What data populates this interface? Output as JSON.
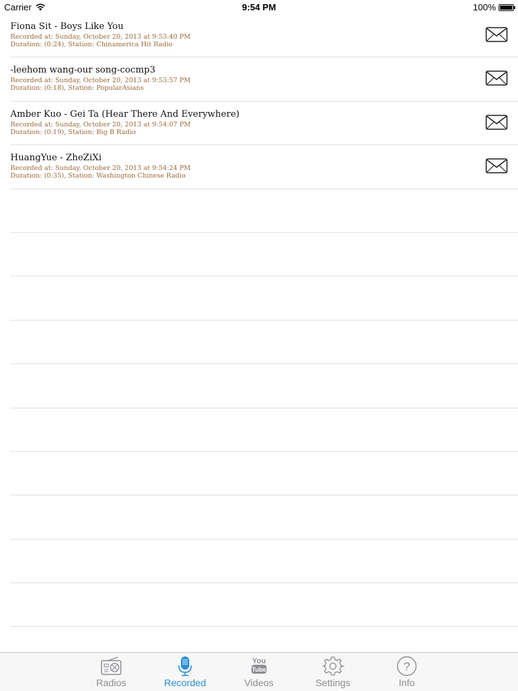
{
  "status_bar": {
    "carrier": "Carrier",
    "time": "9:54 PM",
    "battery": "100%"
  },
  "recordings": [
    {
      "title": "Fiona Sit - Boys Like You",
      "recorded_at": "Recorded at: Sunday, October 20, 2013 at 9:53:40  PM",
      "details": "Duration: (0:24), Station: Chinamerica Hit Radio",
      "action_icon": "envelope-icon"
    },
    {
      "title": "-leehom wang-our song-cocmp3",
      "recorded_at": "Recorded at: Sunday, October 20, 2013 at 9:53:57  PM",
      "details": "Duration: (0:18), Station: PopularAsians",
      "action_icon": "envelope-icon"
    },
    {
      "title": "Amber Kuo - Gei Ta (Hear There And Everywhere)",
      "recorded_at": "Recorded at: Sunday, October 20, 2013 at 9:54:07  PM",
      "details": "Duration: (0:19), Station: Big B Radio",
      "action_icon": "envelope-icon"
    },
    {
      "title": "HuangYue - ZheZiXi",
      "recorded_at": "Recorded at: Sunday, October 20, 2013 at 9:54:24  PM",
      "details": "Duration: (0:35), Station: Washington Chinese Radio",
      "action_icon": "envelope-icon"
    }
  ],
  "tab_bar": {
    "active_color": "#2a8fd6",
    "inactive_color": "#8e8e93",
    "tabs": [
      {
        "label": "Radios",
        "icon": "radio-icon",
        "active": false
      },
      {
        "label": "Recorded",
        "icon": "microphone-icon",
        "active": true
      },
      {
        "label": "Videos",
        "icon": "youtube-icon",
        "active": false
      },
      {
        "label": "Settings",
        "icon": "gear-icon",
        "active": false
      },
      {
        "label": "Info",
        "icon": "question-icon",
        "active": false
      }
    ],
    "youtube_icon_text": {
      "top": "You",
      "bottom": "Tube"
    },
    "info_icon_glyph": "?"
  }
}
